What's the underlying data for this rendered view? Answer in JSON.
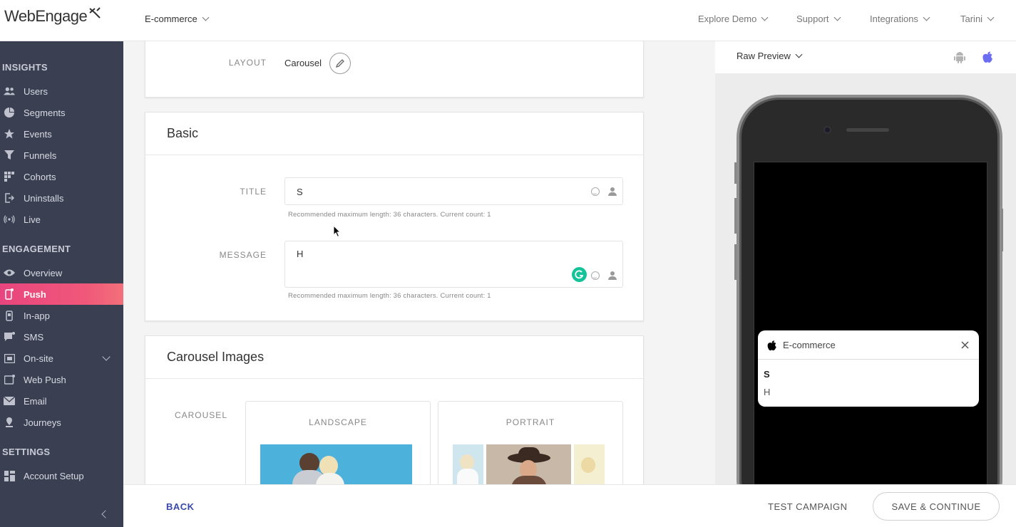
{
  "header": {
    "logo_text": "WebEngage",
    "project": "E-commerce",
    "nav": [
      "Explore Demo",
      "Support",
      "Integrations",
      "Tarini"
    ]
  },
  "sidebar": {
    "sections": [
      {
        "title": "INSIGHTS",
        "items": [
          "Users",
          "Segments",
          "Events",
          "Funnels",
          "Cohorts",
          "Uninstalls",
          "Live"
        ]
      },
      {
        "title": "ENGAGEMENT",
        "items": [
          "Overview",
          "Push",
          "In-app",
          "SMS",
          "On-site",
          "Web Push",
          "Email",
          "Journeys"
        ]
      },
      {
        "title": "SETTINGS",
        "items": [
          "Account Setup"
        ]
      }
    ],
    "active_item": "Push"
  },
  "layout_card": {
    "label": "LAYOUT",
    "value": "Carousel"
  },
  "basic": {
    "title": "Basic",
    "title_label": "TITLE",
    "title_value": "S",
    "title_hint": "Recommended maximum length: 36 characters. Current count: 1",
    "message_label": "MESSAGE",
    "message_value": "H",
    "message_hint": "Recommended maximum length: 36 characters. Current count: 1"
  },
  "carousel": {
    "title": "Carousel Images",
    "label": "CAROUSEL",
    "options": [
      "LANDSCAPE",
      "PORTRAIT"
    ]
  },
  "preview": {
    "mode": "Raw Preview",
    "notification": {
      "app": "E-commerce",
      "title": "S",
      "message": "H"
    }
  },
  "footer": {
    "back": "BACK",
    "test": "TEST CAMPAIGN",
    "save": "SAVE & CONTINUE"
  },
  "colors": {
    "sidebar_bg": "#3a3f52",
    "active": "#e8457e",
    "accent_blue": "#3949ab",
    "ios_icon": "#6b6ef0"
  }
}
